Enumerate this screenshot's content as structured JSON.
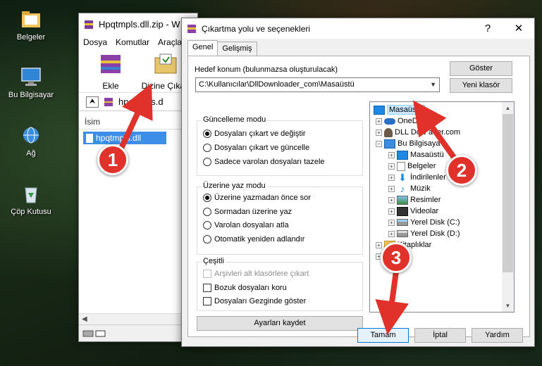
{
  "desktop": {
    "icons": [
      {
        "label": "Belgeler",
        "icon": "folder-icon"
      },
      {
        "label": "Bu Bilgisayar",
        "icon": "computer-icon"
      },
      {
        "label": "Ağ",
        "icon": "network-icon"
      },
      {
        "label": "Çöp Kutusu",
        "icon": "recycle-bin-icon"
      }
    ]
  },
  "winrar": {
    "title": "Hpqtmpls.dll.zip - W",
    "menu": [
      "Dosya",
      "Komutlar",
      "Araçla"
    ],
    "toolbar": {
      "extract_label": "Ekle",
      "extract_to_label": "Dizine Çıkart"
    },
    "path": "hpqtmpls.d",
    "column_name": "İsim",
    "file_name": "hpqtmpls.dll"
  },
  "dialog": {
    "title": "Çıkartma yolu ve seçenekleri",
    "close": "✕",
    "help": "?",
    "tabs": [
      "Genel",
      "Gelişmiş"
    ],
    "dest_label": "Hedef konum (bulunmazsa oluşturulacak)",
    "dest_value": "C:\\Kullanıcılar\\DllDownloader_com\\Masaüstü",
    "show_button": "Göster",
    "new_folder_button": "Yeni klasör",
    "update_mode": {
      "title": "Güncelleme modu",
      "options": [
        "Dosyaları çıkart ve değiştir",
        "Dosyaları çıkart ve güncelle",
        "Sadece varolan dosyaları tazele"
      ],
      "selected": 0
    },
    "overwrite_mode": {
      "title": "Üzerine yaz modu",
      "options": [
        "Üzerine yazmadan önce sor",
        "Sormadan üzerine yaz",
        "Varolan dosyaları atla",
        "Otomatik yeniden adlandır"
      ],
      "selected": 0
    },
    "misc": {
      "title": "Çeşitli",
      "options": [
        "Arşivleri alt klasörlere çıkart",
        "Bozuk dosyaları koru",
        "Dosyaları Gezginde göster"
      ]
    },
    "save_settings_button": "Ayarları kaydet",
    "tree": [
      "Masaüstü",
      "OneDrive",
      "DLL Downloader.com",
      "Bu Bilgisayar",
      "Masaüstü",
      "Belgeler",
      "İndirilenler",
      "Müzik",
      "Resimler",
      "Videolar",
      "Yerel Disk (C:)",
      "Yerel Disk (D:)",
      "Kitaplıklar"
    ],
    "tree_truncated": {
      "onedrive": "OneDri",
      "dll": "DLL Dow",
      "dll_tail": "ader.com",
      "pc": "Bu Bilgisaya",
      "lib": "Kitaplıklar"
    },
    "ok_button": "Tamam",
    "cancel_button": "İptal",
    "help_button": "Yardım"
  },
  "annotations": [
    "1",
    "2",
    "3"
  ],
  "colors": {
    "badge": "#e0312a",
    "selection": "#cce8ff",
    "file_highlight": "#3c8ee8"
  }
}
